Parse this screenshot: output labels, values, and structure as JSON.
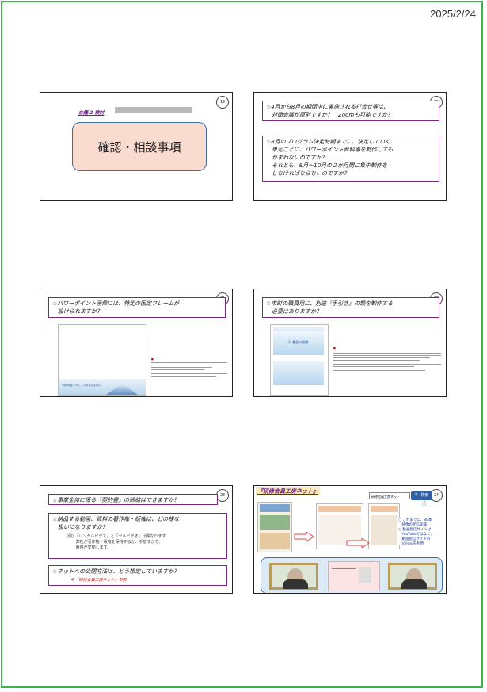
{
  "date": "2025/2/24",
  "slides": [
    {
      "number": "19",
      "topic_label": "会議 2 検討",
      "title": "確認・相談事項"
    },
    {
      "number": "20",
      "q1": "☆4月から8月の期間中に実施される打合せ等は、\n　対面会議が原則ですか？　Zoomも可能ですか？",
      "q2": "☆8月のプログラム決定時期までに、決定していく\n　単元ごとに、パワーポイント資料等を制作しても\n　かまわないのですか？\n　それとも、8月〜10月の２か月間に集中制作を\n　しなければならないのですか？"
    },
    {
      "number": "21",
      "q1": "☆パワーポイント画像には、特定の固定フレームが\n　設けられますか？",
      "thumb_caption": "令和6年度 いやし・人権 みんなの心"
    },
    {
      "number": "22",
      "q1": "☆市町の職員用に、別途『手引き』の類を制作する\n　必要はありますか？",
      "thumb_title": "3. 委員の組織"
    },
    {
      "number": "23",
      "q1": "☆事業全体に係る『契約書』の締結はできますか？",
      "q2": "☆納品する動画、資料の著作権・版権は、どの様な\n　扱いになりますか？",
      "q2_note": "(例) 「レンタルビデオ」と「セルビデオ」は異なります。\n　　 弊社が著作権・版権を保持するか、手放すかで、\n　　 費用が変動します。",
      "q3": "☆ネットへの公開方法は、どう想定していますか？",
      "q3_note": "4.『研修会員工房ネット』参照"
    },
    {
      "number": "24",
      "title": "『研修会員工房ネット』",
      "search_placeholder": "研修会員工房ネット",
      "search_button": "🔍 検索",
      "note": "○ これまでに、88本\n　映像の配信実績\n○ 動画配信サイトは\n　YouTubeではなく、\n　動画配信サイトの\n　Vimeoを利用"
    }
  ]
}
